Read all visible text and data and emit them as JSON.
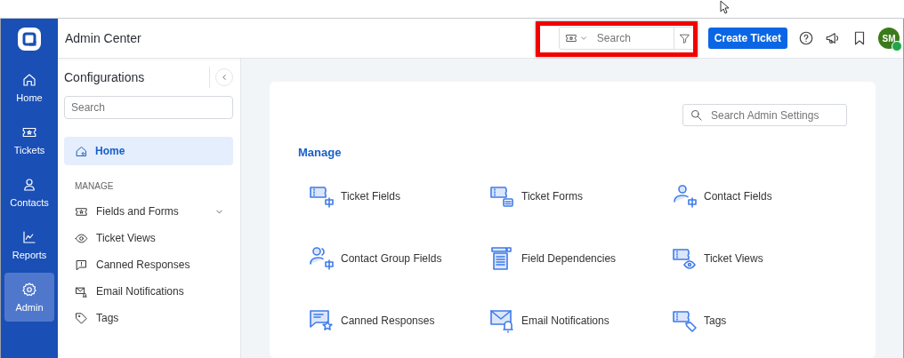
{
  "header": {
    "title": "Admin Center",
    "search_placeholder": "Search",
    "create_button": "Create Ticket",
    "avatar": "SM",
    "online": true
  },
  "rail": [
    {
      "label": "Home",
      "selected": false
    },
    {
      "label": "Tickets",
      "selected": false
    },
    {
      "label": "Contacts",
      "selected": false
    },
    {
      "label": "Reports",
      "selected": false
    },
    {
      "label": "Admin",
      "selected": true
    }
  ],
  "sidebar": {
    "title": "Configurations",
    "search_placeholder": "Search",
    "section": "MANAGE",
    "top": [
      {
        "label": "Home",
        "selected": true
      }
    ],
    "items": [
      {
        "label": "Fields and Forms",
        "kind": "group"
      },
      {
        "label": "Ticket Views",
        "kind": "link"
      },
      {
        "label": "Canned Responses",
        "kind": "link"
      },
      {
        "label": "Email Notifications",
        "kind": "link"
      },
      {
        "label": "Tags",
        "kind": "link"
      }
    ]
  },
  "content": {
    "search_placeholder": "Search Admin Settings",
    "section": "Manage",
    "items": [
      "Ticket Fields",
      "Ticket Forms",
      "Contact Fields",
      "Contact Group Fields",
      "Field Dependencies",
      "Ticket Views",
      "Canned Responses",
      "Email Notifications",
      "Tags"
    ]
  }
}
